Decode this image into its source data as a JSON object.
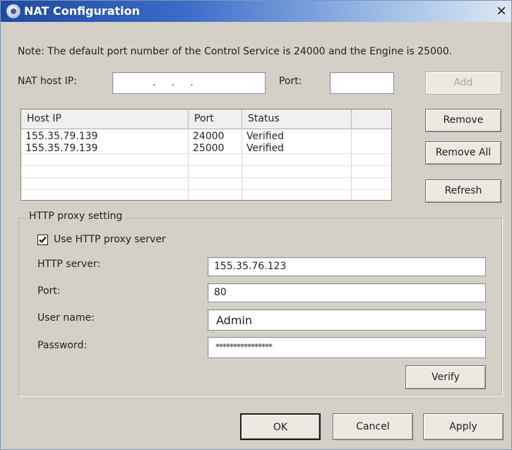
{
  "window": {
    "title": "NAT Configuration",
    "close_glyph": "×"
  },
  "note": "Note: The default port number of the Control Service is 24000 and the Engine is 25000.",
  "nat": {
    "host_ip_label": "NAT host IP:",
    "ip_dots": ".     .     .",
    "port_label": "Port:",
    "port_value": "",
    "add_label": "Add"
  },
  "table": {
    "columns": [
      "Host IP",
      "Port",
      "Status"
    ],
    "rows": [
      {
        "host_ip": "155.35.79.139",
        "port": "24000",
        "status": "Verified"
      },
      {
        "host_ip": "155.35.79.139",
        "port": "25000",
        "status": "Verified"
      }
    ]
  },
  "side_buttons": {
    "remove": "Remove",
    "remove_all": "Remove All",
    "refresh": "Refresh"
  },
  "proxy": {
    "group_label": "HTTP proxy setting",
    "use_proxy_label": "Use HTTP proxy server",
    "use_proxy_checked": true,
    "server_label": "HTTP server:",
    "server_value": "155.35.76.123",
    "port_label": "Port:",
    "port_value": "80",
    "user_label": "User name:",
    "user_value": "Admin",
    "password_label": "Password:",
    "password_value": "****************",
    "verify_label": "Verify"
  },
  "footer": {
    "ok": "OK",
    "cancel": "Cancel",
    "apply": "Apply"
  },
  "icons": {
    "title_icon": "globe-network-icon",
    "check_icon": "checkmark-icon"
  },
  "colors": {
    "dialog_bg": "#d4d0c8",
    "titlebar_start": "#1f4a9e",
    "titlebar_end": "#dde7f3"
  }
}
